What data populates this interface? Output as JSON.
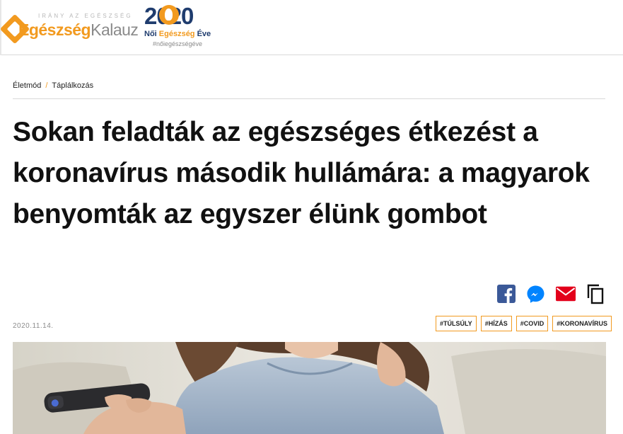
{
  "header": {
    "logo": {
      "tagline": "IRÁNY AZ EGÉSZSÉG",
      "name_primary": "Egészség",
      "name_secondary": "Kalauz"
    },
    "badge": {
      "year": "2020",
      "line1_a": "Női ",
      "line1_highlight": "Egészség",
      "line1_b": " Éve",
      "hashtag": "#nőiegészségéve"
    }
  },
  "breadcrumb": {
    "items": [
      "Életmód",
      "Táplálkozás"
    ],
    "separator": "/"
  },
  "article": {
    "title": "Sokan feladták az egészséges étkezést a koronavírus második hullámára: a magyarok benyomták az egyszer élünk gombot",
    "date": "2020.11.14.",
    "tags": [
      "#TÚLSÚLY",
      "#HÍZÁS",
      "#COVID",
      "#KORONAVÍRUS"
    ]
  },
  "share": {
    "icons": [
      "facebook-icon",
      "messenger-icon",
      "email-icon",
      "copy-link-icon"
    ]
  },
  "colors": {
    "accent": "#f29a1f",
    "brand_navy": "#1f3c6e",
    "facebook": "#3b5998",
    "messenger": "#0084ff",
    "email": "#e3001b"
  }
}
